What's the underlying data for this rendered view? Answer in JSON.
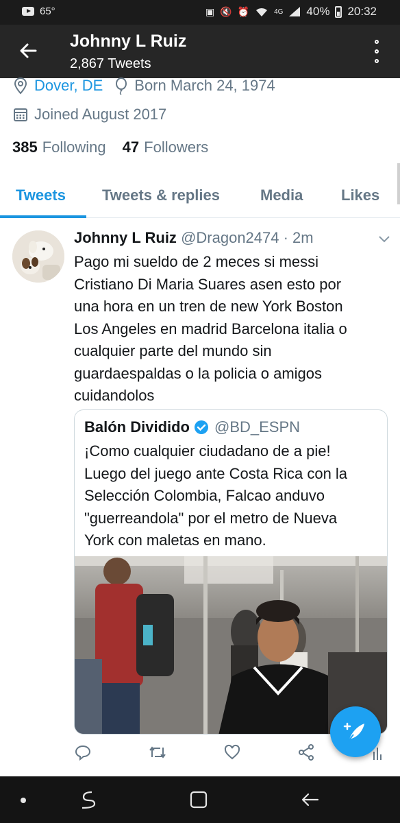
{
  "status_bar": {
    "temperature": "65°",
    "battery": "40%",
    "time": "20:32",
    "icons": [
      "youtube-icon",
      "nfc-icon",
      "mute-icon",
      "alarm-icon",
      "wifi-icon",
      "lte-icon",
      "signal-icon",
      "battery-icon"
    ]
  },
  "header": {
    "name": "Johnny L Ruiz",
    "tweet_count": "2,867 Tweets"
  },
  "profile": {
    "location": "Dover, DE",
    "born": "Born March 24, 1974",
    "joined": "Joined August 2017",
    "following_count": "385",
    "following_label": "Following",
    "followers_count": "47",
    "followers_label": "Followers"
  },
  "tabs": [
    {
      "label": "Tweets",
      "active": true
    },
    {
      "label": "Tweets & replies",
      "active": false
    },
    {
      "label": "Media",
      "active": false
    },
    {
      "label": "Likes",
      "active": false
    }
  ],
  "tweet": {
    "name": "Johnny L Ruiz",
    "handle_time": "@Dragon2474 · 2m",
    "text_lines": [
      "Pago mi sueldo de 2 meces si messi",
      "Cristiano Di Maria Suares asen esto por",
      "una hora en un tren de new York Boston",
      "Los Angeles en madrid Barcelona italia o",
      "cualquier parte del mundo sin",
      "guardaespaldas o la policia o amigos",
      "cuidandolos"
    ],
    "quote": {
      "name": "Balón Dividido",
      "handle": "@BD_ESPN",
      "text_lines": [
        "¡Como cualquier ciudadano de a pie!",
        "Luego del juego ante Costa Rica con la",
        "Selección Colombia, Falcao anduvo",
        "\"guerreandola\" por el metro de Nueva",
        "York con maletas en mano."
      ]
    }
  },
  "colors": {
    "accent": "#1b95e0",
    "fab": "#1da1f2",
    "header_bg": "#262626",
    "status_bg": "#1b1b1b",
    "nav_bg": "#141414",
    "muted_text": "#657786"
  }
}
